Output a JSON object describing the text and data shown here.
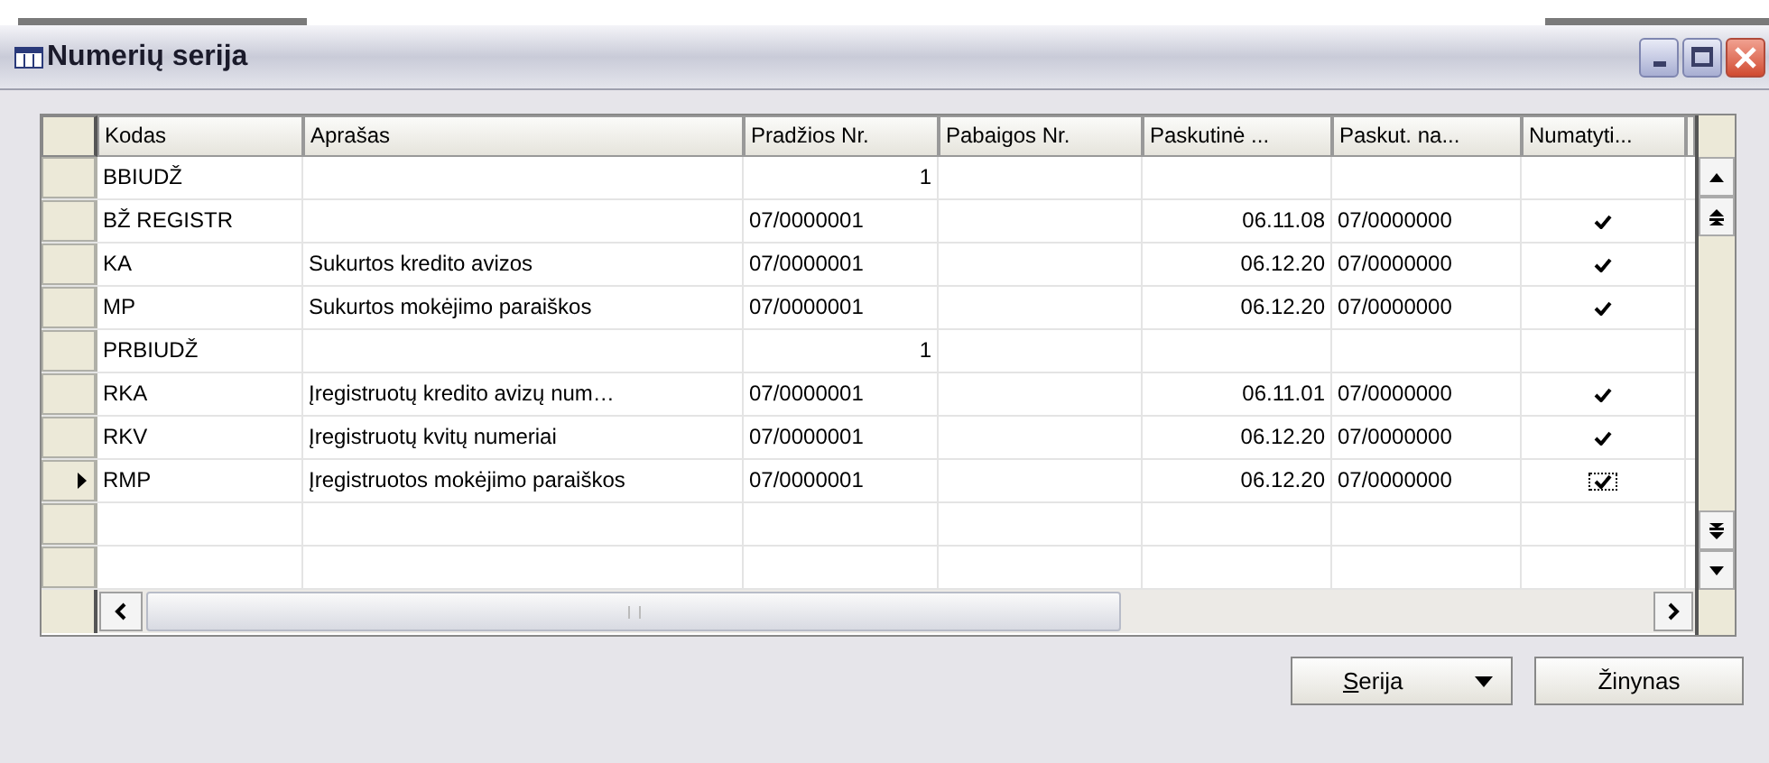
{
  "window": {
    "title": "Numerių serija"
  },
  "table": {
    "columns": [
      "Kodas",
      "Aprašas",
      "Pradžios Nr.",
      "Pabaigos Nr.",
      "Paskutinė ...",
      "Paskut. na...",
      "Numatyti..."
    ],
    "rows": [
      {
        "kind": "integer",
        "cells": [
          "BBIUDŽ",
          "",
          "1",
          "",
          "",
          ""
        ],
        "checked": false,
        "selected": false
      },
      {
        "kind": "code",
        "cells": [
          "BŽ REGISTR",
          "",
          "07/0000001",
          "",
          "06.11.08",
          "07/0000000"
        ],
        "checked": true,
        "selected": false
      },
      {
        "kind": "code",
        "cells": [
          "KA",
          "Sukurtos kredito avizos",
          "07/0000001",
          "",
          "06.12.20",
          "07/0000000"
        ],
        "checked": true,
        "selected": false
      },
      {
        "kind": "code",
        "cells": [
          "MP",
          "Sukurtos mokėjimo paraiškos",
          "07/0000001",
          "",
          "06.12.20",
          "07/0000000"
        ],
        "checked": true,
        "selected": false
      },
      {
        "kind": "integer",
        "cells": [
          "PRBIUDŽ",
          "",
          "1",
          "",
          "",
          ""
        ],
        "checked": false,
        "selected": false
      },
      {
        "kind": "code",
        "cells": [
          "RKA",
          "Įregistruotų kredito avizų num…",
          "07/0000001",
          "",
          "06.11.01",
          "07/0000000"
        ],
        "checked": true,
        "selected": false
      },
      {
        "kind": "code",
        "cells": [
          "RKV",
          "Įregistruotų kvitų numeriai",
          "07/0000001",
          "",
          "06.12.20",
          "07/0000000"
        ],
        "checked": true,
        "selected": false
      },
      {
        "kind": "code",
        "cells": [
          "RMP",
          "Įregistruotos mokėjimo paraiškos",
          "07/0000001",
          "",
          "06.12.20",
          "07/0000000"
        ],
        "checked": true,
        "selected": true
      }
    ]
  },
  "buttons": [
    {
      "label": "Serija",
      "kind": "dropdown"
    },
    {
      "label": "Žinynas",
      "kind": "plain"
    }
  ]
}
